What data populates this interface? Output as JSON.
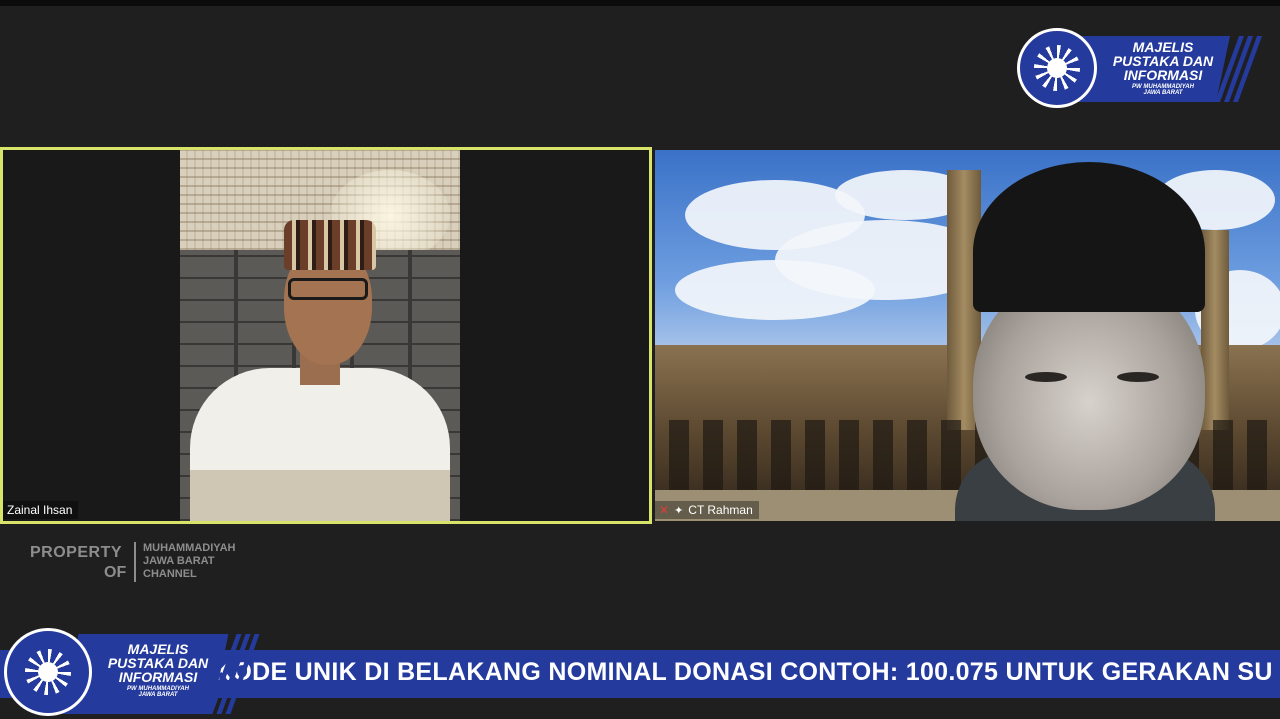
{
  "logo": {
    "line1": "MAJELIS",
    "line2": "PUSTAKA DAN",
    "line3": "INFORMASI",
    "line4": "PW MUHAMMADIYAH",
    "line5": "JAWA BARAT"
  },
  "participants": [
    {
      "name": "Zainal Ihsan",
      "active_speaker": true
    },
    {
      "name": "CT Rahman",
      "active_speaker": false,
      "mic": "muted"
    }
  ],
  "watermark": {
    "property": "PROPERTY",
    "of": "OF",
    "ch1": "MUHAMMADIYAH",
    "ch2": "JAWA BARAT",
    "ch3": "CHANNEL"
  },
  "ticker": {
    "text": "KODE UNIK DI BELAKANG NOMINAL DONASI CONTOH: 100.075 UNTUK GERAKAN SU"
  },
  "colors": {
    "brand_blue": "#243a9c",
    "active_speaker_border": "#d8e36a",
    "background": "#1f1f1f"
  }
}
